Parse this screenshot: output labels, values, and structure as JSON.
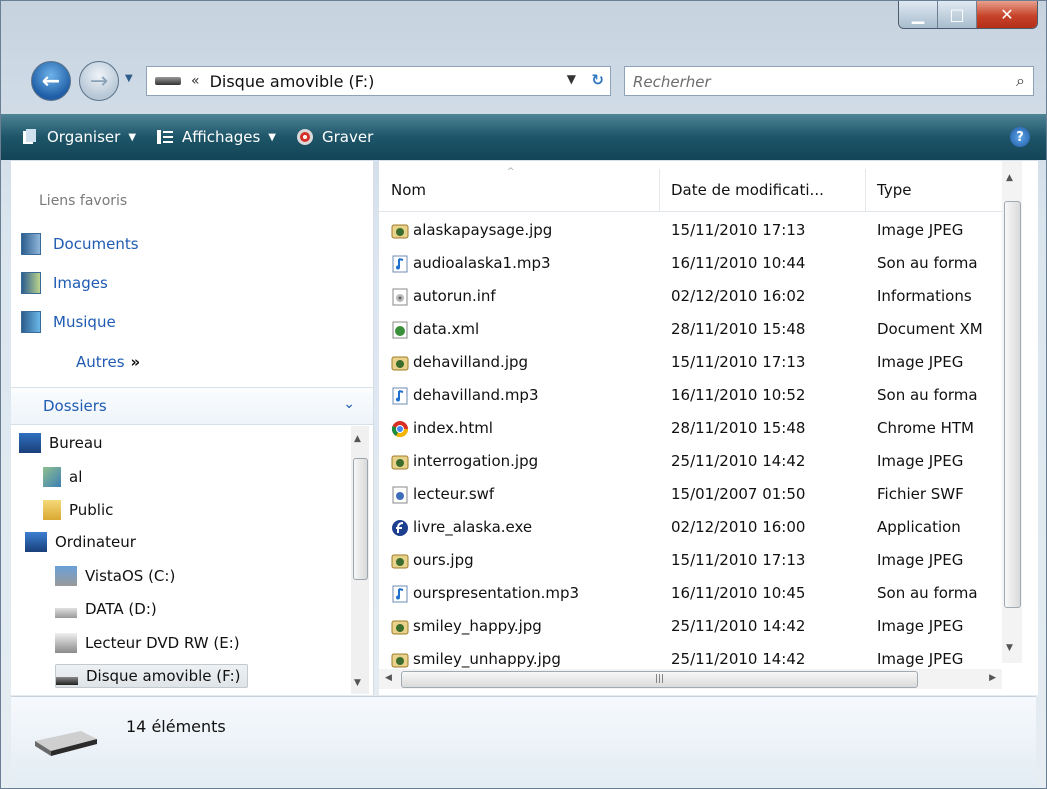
{
  "window": {
    "caption_buttons": [
      "minimize-icon",
      "maximize-icon",
      "close-icon"
    ]
  },
  "address": {
    "chevron": "«",
    "path": "Disque amovible (F:)",
    "search_placeholder": "Recherher"
  },
  "toolbar": {
    "organize": "Organiser",
    "views": "Affichages",
    "burn": "Graver",
    "help": "?"
  },
  "favorites": {
    "header": "Liens favoris",
    "items": [
      "Documents",
      "Images",
      "Musique"
    ],
    "more": "Autres",
    "more_glyph": "»"
  },
  "folders": {
    "header": "Dossiers",
    "items": [
      "Bureau",
      "al",
      "Public",
      "Ordinateur",
      "VistaOS (C:)",
      "DATA (D:)",
      "Lecteur DVD RW (E:)",
      "Disque amovible (F:)"
    ],
    "selected": "Disque amovible (F:)"
  },
  "columns": {
    "name": "Nom",
    "date": "Date de modificati...",
    "type": "Type"
  },
  "files": [
    {
      "name": "alaskapaysage.jpg",
      "date": "15/11/2010 17:13",
      "type": "Image JPEG",
      "icon": "jpeg-image-icon"
    },
    {
      "name": "audioalaska1.mp3",
      "date": "16/11/2010 10:44",
      "type": "Son au forma",
      "icon": "audio-file-icon"
    },
    {
      "name": "autorun.inf",
      "date": "02/12/2010 16:02",
      "type": "Informations",
      "icon": "setup-info-icon"
    },
    {
      "name": "data.xml",
      "date": "28/11/2010 15:48",
      "type": "Document XM",
      "icon": "xml-document-icon"
    },
    {
      "name": "dehavilland.jpg",
      "date": "15/11/2010 17:13",
      "type": "Image JPEG",
      "icon": "jpeg-image-icon"
    },
    {
      "name": "dehavilland.mp3",
      "date": "16/11/2010 10:52",
      "type": "Son au forma",
      "icon": "audio-file-icon"
    },
    {
      "name": "index.html",
      "date": "28/11/2010 15:48",
      "type": "Chrome HTM",
      "icon": "chrome-html-icon"
    },
    {
      "name": "interrogation.jpg",
      "date": "25/11/2010 14:42",
      "type": "Image JPEG",
      "icon": "jpeg-image-icon"
    },
    {
      "name": "lecteur.swf",
      "date": "15/01/2007 01:50",
      "type": "Fichier SWF",
      "icon": "swf-file-icon"
    },
    {
      "name": "livre_alaska.exe",
      "date": "02/12/2010 16:00",
      "type": "Application",
      "icon": "flash-app-icon"
    },
    {
      "name": "ours.jpg",
      "date": "15/11/2010 17:13",
      "type": "Image JPEG",
      "icon": "jpeg-image-icon"
    },
    {
      "name": "ourspresentation.mp3",
      "date": "16/11/2010 10:45",
      "type": "Son au forma",
      "icon": "audio-file-icon"
    },
    {
      "name": "smiley_happy.jpg",
      "date": "25/11/2010 14:42",
      "type": "Image JPEG",
      "icon": "jpeg-image-icon"
    },
    {
      "name": "smiley_unhappy.jpg",
      "date": "25/11/2010 14:42",
      "type": "Image JPEG",
      "icon": "jpeg-image-icon"
    }
  ],
  "status": {
    "count": "14 éléments"
  },
  "colors": {
    "toolbar": "#1e5568",
    "link": "#1f5bb2",
    "close": "#c6432a"
  }
}
